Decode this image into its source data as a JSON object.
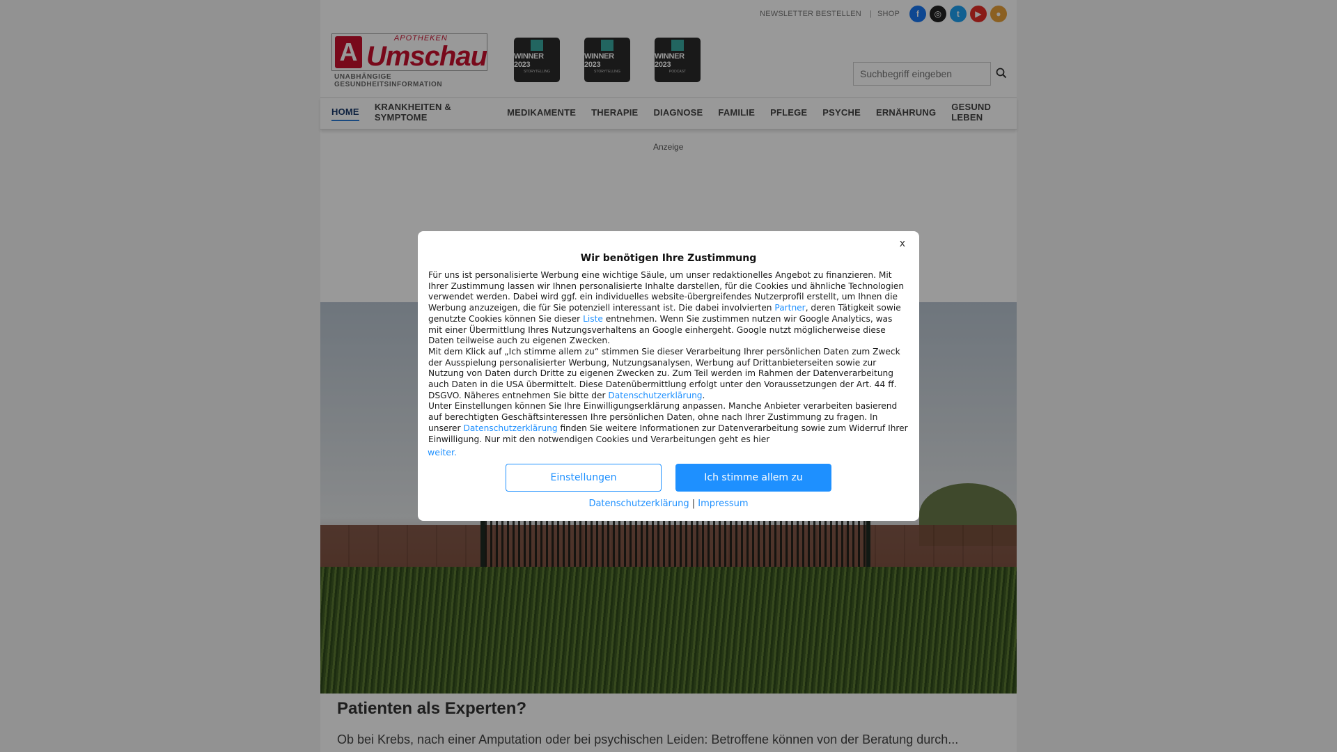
{
  "topbar": {
    "newsletter": "NEWSLETTER BESTELLEN",
    "shop": "SHOP",
    "social": [
      {
        "icon": "facebook-icon",
        "glyph": "f",
        "color": "#1877f2"
      },
      {
        "icon": "instagram-icon",
        "glyph": "◎",
        "color": "#222222"
      },
      {
        "icon": "twitter-icon",
        "glyph": "t",
        "color": "#1da1f2"
      },
      {
        "icon": "youtube-icon",
        "glyph": "▶",
        "color": "#e52d27"
      },
      {
        "icon": "user-icon",
        "glyph": "●",
        "color": "#e8a13a"
      }
    ]
  },
  "logo": {
    "letter": "A",
    "small": "APOTHEKEN",
    "big": "Umschau",
    "subtitle": "UNABHÄNGIGE GESUNDHEITSINFORMATION"
  },
  "badges": [
    {
      "title": "WINNER 2023",
      "category": "STORYTELLING"
    },
    {
      "title": "WINNER 2023",
      "category": "STORYTELLING"
    },
    {
      "title": "WINNER 2023",
      "category": "PODCAST"
    }
  ],
  "search": {
    "placeholder": "Suchbegriff eingeben"
  },
  "nav": [
    "HOME",
    "KRANKHEITEN & SYMPTOME",
    "MEDIKAMENTE",
    "THERAPIE",
    "DIAGNOSE",
    "FAMILIE",
    "PFLEGE",
    "PSYCHE",
    "ERNÄHRUNG",
    "GESUND LEBEN"
  ],
  "ad_label": "Anzeige",
  "article": {
    "title": "Patienten als Experten?",
    "teaser": "Ob bei Krebs, nach einer Amputation oder bei psychischen Leiden: Betroffene können von der Beratung durch..."
  },
  "consent": {
    "close": "x",
    "title": "Wir benötigen Ihre Zustimmung",
    "p1_a": "Für uns ist personalisierte Werbung eine wichtige Säule, um unser redaktionelles Angebot zu finanzieren. Mit Ihrer Zustimmung lassen wir Ihnen personalisierte Inhalte darstellen, für die Cookies und ähnliche Technologien verwendet werden. Dabei wird ggf. ein individuelles website-übergreifendes Nutzerprofil erstellt, um Ihnen die Werbung anzuzeigen, die für Sie potenziell interessant ist. Die dabei involvierten ",
    "p1_link1": "Partner",
    "p1_b": ", deren Tätigkeit sowie genutzte Cookies können Sie dieser ",
    "p1_link2": "Liste",
    "p1_c": " entnehmen. Wenn Sie zustimmen nutzen wir Google Analytics, was mit einer Übermittlung Ihres Nutzungsverhaltens an Google einhergeht. Google nutzt möglicherweise diese Daten teilweise auch zu eigenen Zwecken.",
    "p2_a": "Mit dem Klick auf „Ich stimme allem zu“ stimmen Sie dieser Verarbeitung Ihrer persönlichen Daten zum Zweck der Ausspielung personalisierter Werbung, Nutzungsanalysen, Werbung auf Drittanbieterseiten sowie zur Nutzung von Daten durch Dritte zu eigenen Zwecken zu. Zum Teil werden im Rahmen der Datenverarbeitung auch Daten in die USA übermittelt. Diese Datenübermittlung erfolgt unter den Voraussetzungen der Art. 44 ff. DSGVO. Näheres entnehmen Sie bitte der ",
    "p2_link": "Datenschutzerklärung",
    "p2_b": ".",
    "p3_a": "Unter Einstellungen können Sie Ihre Einwilligungserklärung anpassen. Manche Anbieter verarbeiten basierend auf berechtigten Geschäftsinteressen Ihre persönlichen Daten, ohne nach Ihrer Zustimmung zu fragen. In unserer ",
    "p3_link": "Datenschutzerklärung",
    "p3_b": " finden Sie weitere Informationen zur Datenverarbeitung sowie zum Widerruf Ihrer Einwilligung. Nur mit den notwendigen Cookies und Verarbeitungen geht es hier",
    "weiter": "weiter.",
    "btn_settings": "Einstellungen",
    "btn_accept": "Ich stimme allem zu",
    "footer_privacy": "Datenschutzerklärung",
    "footer_sep": "|",
    "footer_imprint": "Impressum"
  }
}
